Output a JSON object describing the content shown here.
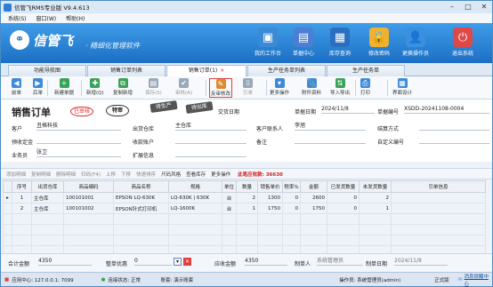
{
  "window": {
    "title": "信管飞RMS专业版 V9.4.613",
    "min": "–",
    "max": "□",
    "close": "✕"
  },
  "menu": [
    "系统(S)",
    "窗口(W)",
    "帮助(H)"
  ],
  "banner": {
    "logo_mark": "⚭",
    "logo_text": "信管飞",
    "tagline": "· 精细化管理软件",
    "buttons": [
      {
        "label": "我的工作台",
        "icon": "desktop-icon",
        "glyph": "▣",
        "color": "#3b8ad6"
      },
      {
        "label": "单据中心",
        "icon": "document-center-icon",
        "glyph": "▤",
        "color": "#4a7fd4"
      },
      {
        "label": "库存查询",
        "icon": "warehouse-icon",
        "glyph": "▦",
        "color": "#2b6fbf"
      },
      {
        "label": "修改密码",
        "icon": "lock-icon",
        "glyph": "🔒",
        "color": "#f0b030"
      },
      {
        "label": "更换操作员",
        "icon": "user-icon",
        "glyph": "👤",
        "color": "#3a8fe0"
      },
      {
        "label": "退出系统",
        "icon": "exit-icon",
        "glyph": "⏻",
        "color": "#e04848"
      }
    ]
  },
  "tabs": [
    {
      "label": "功能导航图"
    },
    {
      "label": "销售订单列表"
    },
    {
      "label": "销售订单(1)",
      "close": "×"
    },
    {
      "label": "生产任务单列表"
    },
    {
      "label": "生产任务单"
    }
  ],
  "toolbar": [
    {
      "label": "前单",
      "glyph": "◀",
      "color": "#3d8bd8",
      "icon": "prev-record-icon"
    },
    {
      "label": "后单",
      "glyph": "▶",
      "color": "#3d8bd8",
      "icon": "next-record-icon"
    },
    {
      "label": "新建单据",
      "glyph": "+",
      "color": "#3aa35a",
      "icon": "new-document-icon"
    },
    {
      "label": "新增(Q)",
      "glyph": "✚",
      "color": "#3aa35a",
      "icon": "add-icon"
    },
    {
      "label": "复制新增",
      "glyph": "⧉",
      "color": "#3aa35a",
      "icon": "copy-add-icon"
    },
    {
      "label": "保存(S)",
      "glyph": "▤",
      "color": "#9aa8b8",
      "icon": "save-icon"
    },
    {
      "label": "审核(A)",
      "glyph": "✔",
      "color": "#9aa8b8",
      "icon": "audit-icon"
    },
    {
      "label": "反审核改",
      "glyph": "✎",
      "color": "#e08a2c",
      "icon": "unaudit-edit-icon"
    },
    {
      "label": "引单",
      "glyph": "⇩",
      "color": "#9aa8b8",
      "icon": "import-order-icon"
    },
    {
      "label": "更多操作",
      "glyph": "▾",
      "color": "#3d8bd8",
      "icon": "more-actions-icon"
    },
    {
      "label": "附件资料",
      "glyph": "📎",
      "color": "#3d8bd8",
      "icon": "attachment-icon"
    },
    {
      "label": "导入导出",
      "glyph": "⇅",
      "color": "#3aa35a",
      "icon": "import-export-icon"
    },
    {
      "label": "打印",
      "glyph": "⎙",
      "color": "#3d8bd8",
      "icon": "print-icon"
    },
    {
      "label": "界面设计",
      "glyph": "▦",
      "color": "#3d8bd8",
      "icon": "layout-design-icon"
    }
  ],
  "doc": {
    "title": "销售订单",
    "stamps": [
      "已审核",
      "待审核",
      "待生产",
      "待出库"
    ],
    "stamp_labels": {
      "a": "已审核",
      "b": "特审",
      "c": "待生产",
      "d": "待出库"
    },
    "fields": {
      "delivery_date_label": "交货日期",
      "doc_date_label": "单据日期",
      "doc_date": "2024/11/8",
      "doc_no_label": "单据编号",
      "doc_no": "XSDD-20241108-0004",
      "customer_label": "客户",
      "customer": "丑格科技",
      "warehouse_label": "出货仓库",
      "warehouse": "主仓库",
      "contact_label": "客户联系人",
      "contact": "李旭",
      "settle_label": "结算方式",
      "deposit_label": "预收定金",
      "receipt_label": "收款账户",
      "remark_label": "备注",
      "custom_no_label": "自定义编号",
      "salesman_label": "业务员",
      "salesman": "张卫",
      "extra_label": "扩展信息"
    }
  },
  "grid_toolbar": [
    {
      "label": "添加明细",
      "icon": "add-line-icon",
      "on": false
    },
    {
      "label": "复制明细",
      "icon": "copy-line-icon",
      "on": false
    },
    {
      "label": "删除明细",
      "icon": "delete-line-icon",
      "on": false
    },
    {
      "label": "扫码(F4)",
      "icon": "scan-icon",
      "on": false
    },
    {
      "label": "上移",
      "icon": "up-icon",
      "on": false
    },
    {
      "label": "下移",
      "icon": "down-icon",
      "on": false
    },
    {
      "label": "快速排序",
      "icon": "sort-icon",
      "on": false
    },
    {
      "label": "尺码风格",
      "icon": "size-style-icon",
      "on": true
    },
    {
      "label": "查看库存",
      "icon": "stock-view-icon",
      "on": true
    },
    {
      "label": "更多操作",
      "icon": "grid-more-icon",
      "on": true
    }
  ],
  "receivable": "此笔应收款: 36630",
  "grid": {
    "headers": [
      "序号",
      "出货仓库",
      "商品编码",
      "商品名称",
      "规格",
      "单位",
      "数量",
      "销售单价",
      "税率%",
      "金额",
      "已发货数量",
      "未发货数量",
      "引单信息"
    ],
    "rows": [
      [
        "1",
        "主仓库",
        "100101001",
        "EPSON LQ-630K",
        "LQ-630K | 630K",
        "台",
        "2",
        "1300",
        "0",
        "2600",
        "0",
        "2",
        ""
      ],
      [
        "2",
        "主仓库",
        "100101002",
        "EPSON针式打印机",
        "LQ-1600K",
        "台",
        "1",
        "1750",
        "0",
        "1750",
        "0",
        "1",
        ""
      ]
    ],
    "totals": {
      "qty": "3",
      "amount": "4350",
      "shipped": "0",
      "unshipped": "3"
    }
  },
  "footer": {
    "total_label": "合计金额",
    "total": "4350",
    "discount_label": "整单优惠",
    "discount": "0",
    "receivable_label": "应收金额",
    "receivable": "4350",
    "maker_label": "制单人",
    "maker": "系统管理员",
    "make_date_label": "制单日期",
    "make_date": "2024/11/8"
  },
  "status": {
    "server": "应用中心: 127.0.0.1: 7099",
    "conn": "连接状态: 正常",
    "account": "账套: 演示账套",
    "operator": "操作员: 系统管理员(admin)",
    "edition": "正式版",
    "help": "|  ",
    "msg": "消息提醒中心"
  }
}
